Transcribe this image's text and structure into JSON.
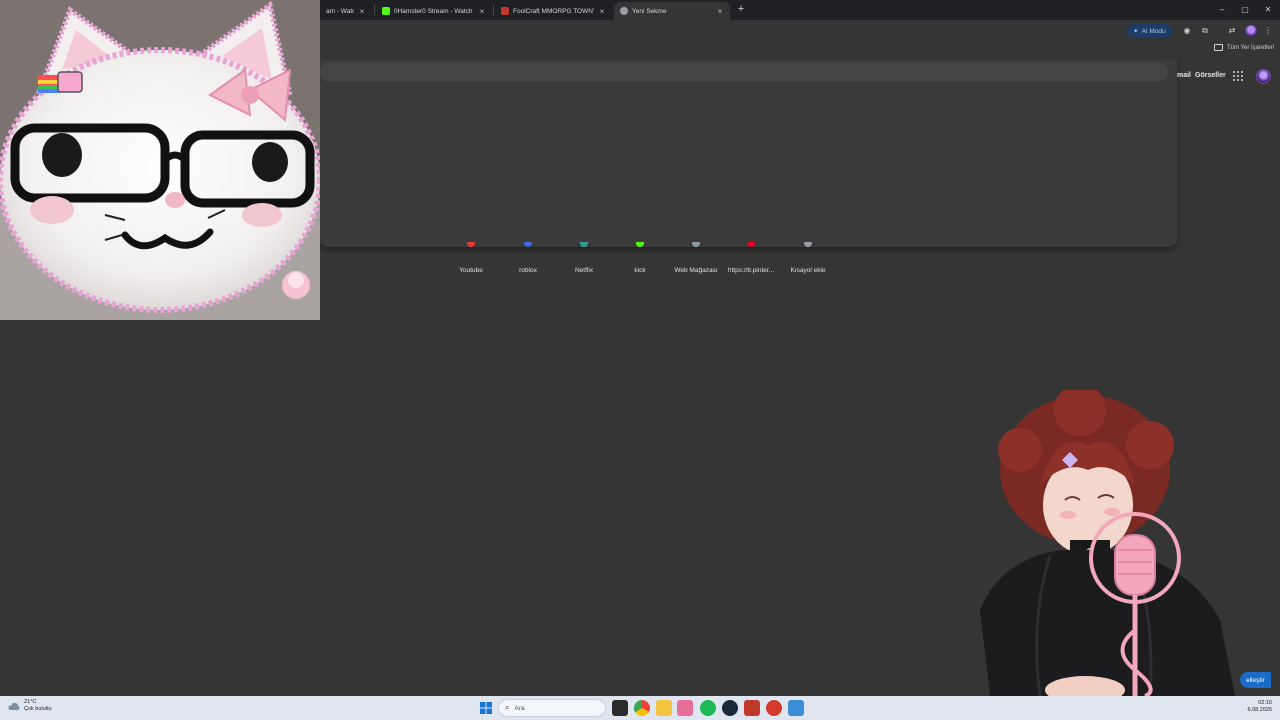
{
  "browser": {
    "tabs": [
      {
        "title": "am - Watch L",
        "favicon_color": "#9146ff"
      },
      {
        "title": "0Hamster0 Stream - Watch Liv",
        "favicon_color": "#53fc18"
      },
      {
        "title": "FoolCraft MMORPG TOWNY | ",
        "favicon_color": "#c0392b"
      },
      {
        "title": "Yeni Sekme",
        "favicon_color": "#9aa0a6"
      }
    ],
    "new_tab_symbol": "+",
    "close_symbol": "×",
    "window_controls": {
      "minimize": "–",
      "maximize": "▢",
      "close": "✕"
    }
  },
  "toolbar": {
    "ai_mode_label": "AI Modu"
  },
  "bookmarks": {
    "all_bookmarks_label": "Tüm Yer İşaretleri"
  },
  "omnibox": {
    "value": "",
    "placeholder": ""
  },
  "google_header": {
    "mail_label": "mail",
    "images_label": "Görseller"
  },
  "shortcuts": [
    {
      "label": "Youtube",
      "icon_color": "#e53935"
    },
    {
      "label": "roblox",
      "icon_color": "#3d6be0"
    },
    {
      "label": "Netflix",
      "icon_color": "#2a9d8f"
    },
    {
      "label": "kick",
      "icon_color": "#53fc18"
    },
    {
      "label": "Web Mağazası",
      "icon_color": "#8aa0a6"
    },
    {
      "label": "https://tr.pinter...",
      "icon_color": "#e60023"
    },
    {
      "label": "Kısayol ekle",
      "icon_color": "#9aa0a6"
    }
  ],
  "overlay": {
    "critique_label": "elleştir"
  },
  "taskbar": {
    "weather_temp": "21°C",
    "weather_desc": "Çok bulutlu",
    "search_placeholder": "Ara",
    "time": "02:16",
    "date": "6.08.2026"
  },
  "colors": {
    "page_bg": "#353535",
    "accent": "#a8c7fa",
    "taskbar_bg": "#dfe6ef"
  }
}
